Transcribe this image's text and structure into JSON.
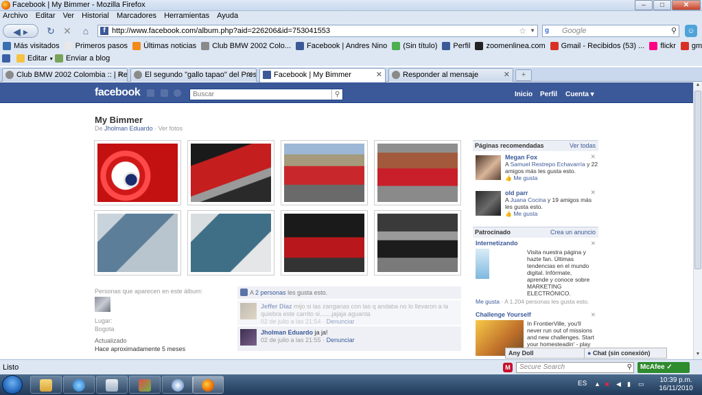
{
  "window": {
    "title": "Facebook | My Bimmer - Mozilla Firefox",
    "minimize": "–",
    "maximize": "□",
    "close": "✕"
  },
  "menu": [
    "Archivo",
    "Editar",
    "Ver",
    "Historial",
    "Marcadores",
    "Herramientas",
    "Ayuda"
  ],
  "nav": {
    "url": "http://www.facebook.com/album.php?aid=226206&id=753041553",
    "search_placeholder": "Google"
  },
  "bookmarks": [
    {
      "label": "Más visitados",
      "color": "#3a6fb0"
    },
    {
      "label": "Primeros pasos",
      "color": "#e8e8e8"
    },
    {
      "label": "Últimas noticias",
      "color": "#f28a1b"
    },
    {
      "label": "Club BMW 2002 Colo...",
      "color": "#8a8a8a"
    },
    {
      "label": "Facebook | Andres Nino",
      "color": "#3b5998"
    },
    {
      "label": "(Sin título)",
      "color": "#4caf50"
    },
    {
      "label": "Perfil",
      "color": "#3b5998"
    },
    {
      "label": "zoomenlinea.com",
      "color": "#222222"
    },
    {
      "label": "Gmail - Recibidos (53) ...",
      "color": "#d93025"
    },
    {
      "label": "flickr",
      "color": "#ff0084"
    },
    {
      "label": "gmail",
      "color": "#d93025"
    }
  ],
  "toolbar2": {
    "edit": "Editar",
    "blog": "Enviar a blog"
  },
  "tabs": [
    {
      "label": "Club BMW 2002 Colombia :: | Reviv...",
      "active": false
    },
    {
      "label": "El segundo \"gallo tapao\" del Presi....",
      "active": false
    },
    {
      "label": "Facebook | My Bimmer",
      "active": true
    },
    {
      "label": "Responder al mensaje",
      "active": false
    }
  ],
  "fb": {
    "logo": "facebook",
    "search_placeholder": "Buscar",
    "nav": {
      "home": "Inicio",
      "profile": "Perfil",
      "account": "Cuenta ▾"
    },
    "album": {
      "title": "My Bimmer",
      "by_prefix": "De",
      "owner": "Jholman Eduardo",
      "sep": " · ",
      "view_photos": "Ver fotos"
    },
    "tagged_label": "Personas que aparecen en este álbum:",
    "location_label": "Lugar:",
    "location": "Bogota",
    "updated_label": "Actualizado",
    "updated": "Hace aproximadamente 5 meses",
    "likes": {
      "prefix": "A",
      "count_link": "2 personas",
      "suffix": "les gusta esto."
    },
    "comments": [
      {
        "name": "Jeffer Diaz",
        "text": "mijo si las zanganas con las q andaba no lo llevaron a la quiebra este carrito si.......jajaja aguanta",
        "date": "02 de julio a las 21:54",
        "action": "Denunciar"
      },
      {
        "name": "Jholman Eduardo",
        "text": "ja ja!",
        "date": "02 de julio a las 21:55",
        "action": "Denunciar"
      }
    ],
    "sidebar": {
      "recommended": {
        "title": "Páginas recomendadas",
        "see_all": "Ver todas",
        "items": [
          {
            "name": "Megan Fox",
            "friend": "Samuel Restrepo Echavarría",
            "rest": " y 22 amigos más les gusta esto.",
            "like": "Me gusta"
          },
          {
            "name": "old parr",
            "friend": "Juana Cocina",
            "rest": " y 19 amigos más les gusta esto.",
            "like": "Me gusta"
          }
        ]
      },
      "sponsored": {
        "title": "Patrocinado",
        "create_ad": "Crea un anuncio",
        "ads": [
          {
            "title": "Internetizando",
            "body": "Visita nuestra página y hazte fan. Últimas tendencias en el mundo digital. Infórmate, aprende y conoce sobre MARKETING ELECTRÓNICO.",
            "like": "Me gusta",
            "likes_text": "A 1.204 personas les gusta esto."
          },
          {
            "title": "Challenge Yourself",
            "body": "In FrontierVille, you'll never run out of missions and new challenges. Start your homesteadin' - play"
          }
        ]
      }
    },
    "chat": {
      "contact": "Any Doll",
      "label": "Chat (sin conexión)"
    }
  },
  "statusbar": {
    "status": "Listo",
    "secure_search": "Secure Search",
    "mcafee": "McAfee"
  },
  "taskbar": {
    "lang": "ES",
    "time": "10:39 p.m.",
    "date": "16/11/2010"
  },
  "colors": {
    "fb_blue": "#3b5998",
    "fb_dark": "#133783",
    "link": "#3b5998"
  }
}
